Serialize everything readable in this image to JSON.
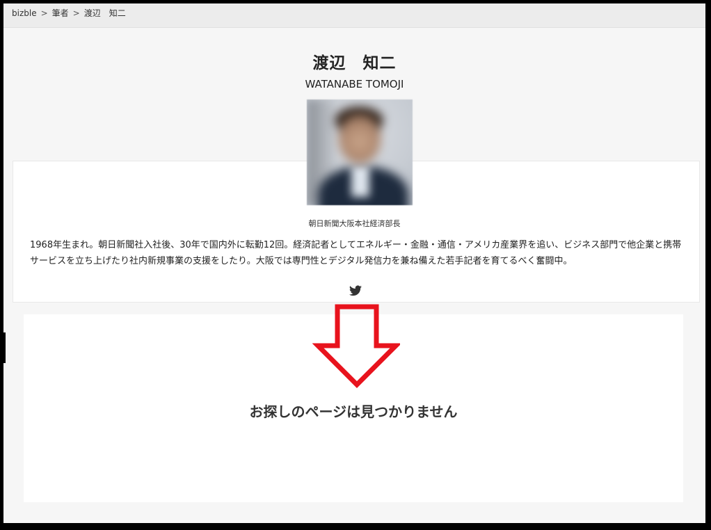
{
  "breadcrumb": {
    "items": [
      "bizble",
      "筆者",
      "渡辺　知二"
    ],
    "separator": ">"
  },
  "author": {
    "name": "渡辺　知二",
    "name_en": "WATANABE TOMOJI",
    "affiliation": "朝日新聞大阪本社経済部長",
    "bio": "1968年生まれ。朝日新聞社入社後、30年で国内外に転勤12回。経済記者としてエネルギー・金融・通信・アメリカ産業界を追い、ビジネス部門で他企業と携帯サービスを立ち上げたり社内新規事業の支援をしたり。大阪では専門性とデジタル発信力を兼ね備えた若手記者を育てるべく奮闘中。"
  },
  "social": {
    "icon": "twitter-icon"
  },
  "not_found": {
    "message": "お探しのページは見つかりません"
  },
  "annotation": {
    "arrow_color": "#e8131d",
    "arrow_icon": "down-arrow-icon"
  }
}
